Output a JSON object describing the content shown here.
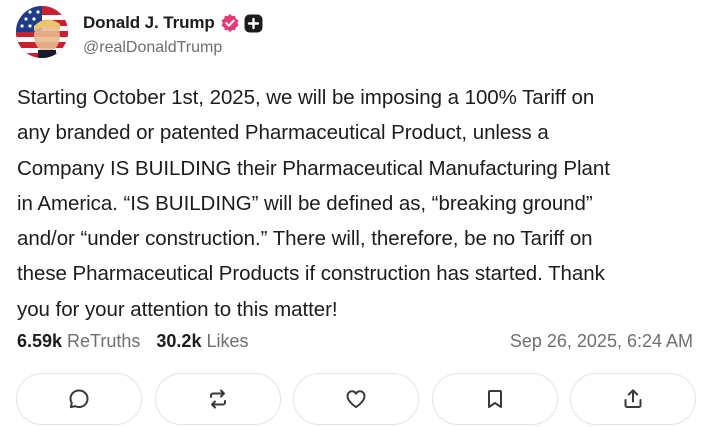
{
  "author": {
    "display_name": "Donald J. Trump",
    "handle": "@realDonaldTrump",
    "verified_icon": "verified-badge-icon",
    "plus_icon": "plus-badge-icon",
    "avatar": "avatar"
  },
  "post": {
    "lines": [
      "Starting October 1st, 2025, we will be imposing a 100% Tariff on",
      "any branded or patented Pharmaceutical Product, unless a",
      "Company IS BUILDING their Pharmaceutical Manufacturing Plant",
      "in America. “IS BUILDING” will be defined as, “breaking ground”",
      "and/or “under construction.” There will, therefore, be no Tariff on",
      "these Pharmaceutical Products if construction has started. Thank",
      "you for your attention to this matter!"
    ]
  },
  "stats": {
    "retruths_count": "6.59k",
    "retruths_label": "ReTruths",
    "likes_count": "30.2k",
    "likes_label": "Likes",
    "timestamp": "Sep 26, 2025, 6:24 AM"
  },
  "actions": [
    {
      "icon": "reply-icon"
    },
    {
      "icon": "retruth-icon"
    },
    {
      "icon": "like-icon"
    },
    {
      "icon": "bookmark-icon"
    },
    {
      "icon": "share-icon"
    }
  ],
  "colors": {
    "verified_badge": "#e5397a",
    "text_primary": "#1c1c1e",
    "text_secondary": "#6e6e73",
    "button_border": "#e3e3e6"
  }
}
